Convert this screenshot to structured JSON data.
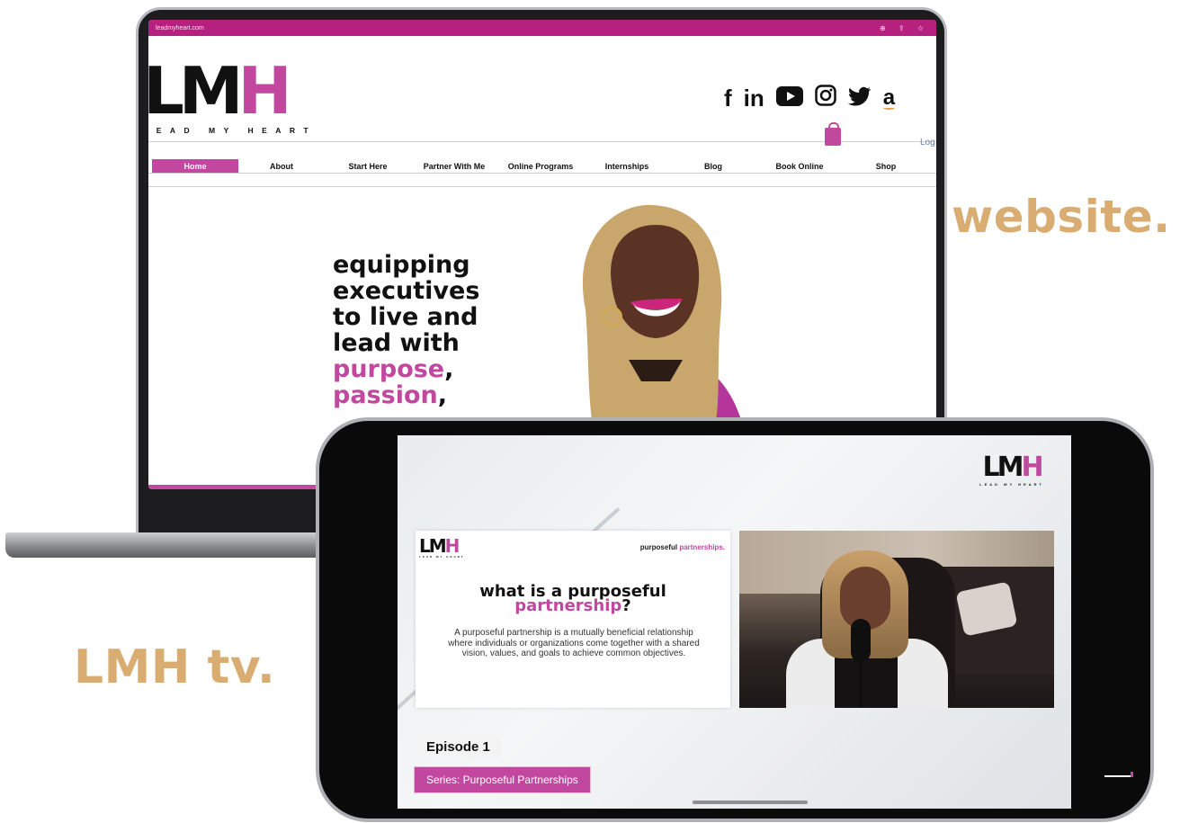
{
  "captions": {
    "website": "website.",
    "tv": "LMH tv."
  },
  "browser": {
    "url": "leadmyheart.com",
    "toolbar_icons": "⊕ ⇪ ☆"
  },
  "site": {
    "logo": {
      "letters_dark": "LM",
      "letters_accent": "H",
      "tagline": "LEAD MY HEART"
    },
    "social_icons": [
      "facebook-icon",
      "linkedin-icon",
      "youtube-icon",
      "instagram-icon",
      "twitter-icon",
      "amazon-icon"
    ],
    "social_glyphs": {
      "facebook": "f",
      "linkedin": "in",
      "youtube": "▶",
      "instagram": "◎",
      "twitter": "🐦",
      "amazon": "a"
    },
    "login_label": "Log",
    "nav": [
      "Home",
      "About",
      "Start Here",
      "Partner With Me",
      "Online Programs",
      "Internships",
      "Blog",
      "Book Online",
      "Shop"
    ],
    "hero": {
      "line1": "equipping",
      "line2": "executives",
      "line3": "to live and",
      "line4": "lead with",
      "line5_accent": "purpose",
      "line5_tail": ",",
      "line6_accent": "passion",
      "line6_tail": ","
    }
  },
  "video": {
    "corner_logo": {
      "letters_dark": "LM",
      "letters_accent": "H",
      "tagline": "LEAD MY HEART"
    },
    "slide": {
      "logo": {
        "letters_dark": "LM",
        "letters_accent": "H",
        "tagline": "LEAD MY HEART"
      },
      "tag_dark": "purposeful ",
      "tag_accent": "partnerships.",
      "title_line1": "what is a purposeful",
      "title_line2_accent": "partnership",
      "title_line2_tail": "?",
      "body": "A purposeful partnership is a mutually beneficial relationship where individuals or organizations come together with a shared vision, values, and goals to achieve common objectives."
    },
    "episode_label": "Episode 1",
    "series_label": "Series: Purposeful Partnerships"
  },
  "colors": {
    "accent_pink": "#c1479f",
    "caption_gold": "#d9ad72",
    "browser_bar": "#b6207f"
  }
}
